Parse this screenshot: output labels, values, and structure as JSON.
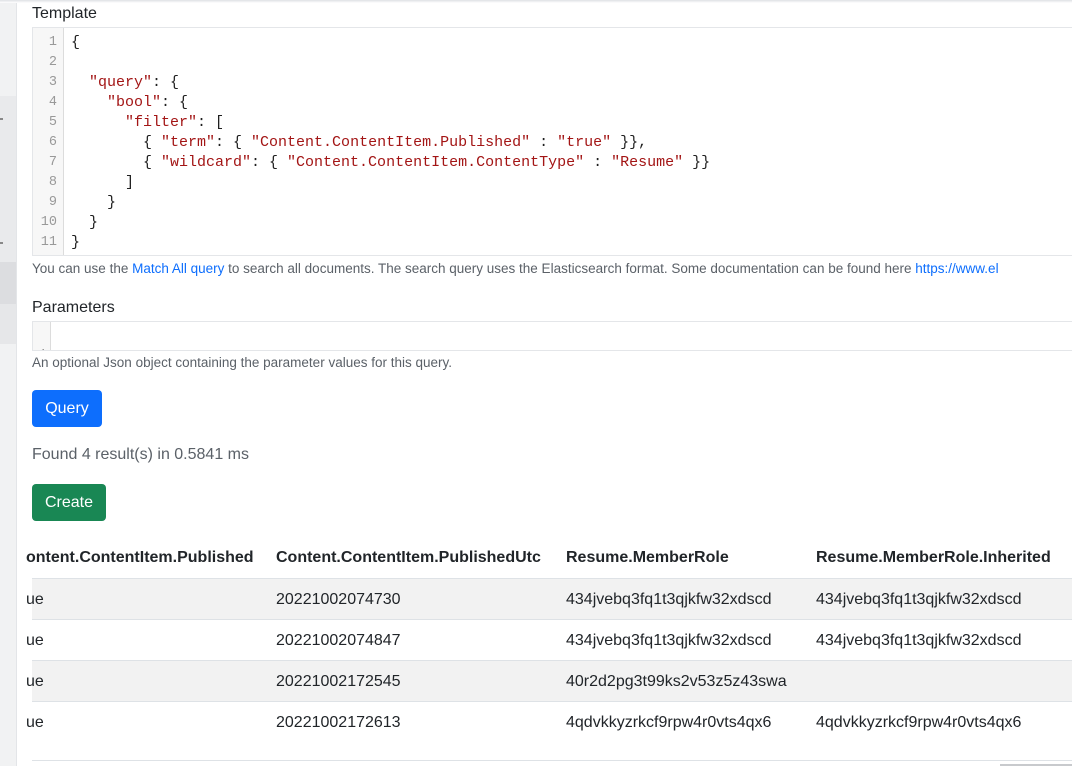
{
  "template": {
    "label": "Template",
    "lines": [
      {
        "n": "1",
        "code": "{"
      },
      {
        "n": "2",
        "code": ""
      },
      {
        "n": "3",
        "code": "  \"query\": {"
      },
      {
        "n": "4",
        "code": "    \"bool\": {"
      },
      {
        "n": "5",
        "code": "      \"filter\": ["
      },
      {
        "n": "6",
        "code": "        { \"term\": { \"Content.ContentItem.Published\" : \"true\" }},"
      },
      {
        "n": "7",
        "code": "        { \"wildcard\": { \"Content.ContentItem.ContentType\" : \"Resume\" }}"
      },
      {
        "n": "8",
        "code": "      ]"
      },
      {
        "n": "9",
        "code": "    }"
      },
      {
        "n": "10",
        "code": "  }"
      },
      {
        "n": "11",
        "code": "}"
      }
    ],
    "help_prefix": "You can use the ",
    "help_link": "Match All query",
    "help_middle": " to search all documents. The search query uses the Elasticsearch format. Some documentation can be found here ",
    "help_url": "https://www.el"
  },
  "parameters": {
    "label": "Parameters",
    "line_no": "1",
    "value": "{ }",
    "help": "An optional Json object containing the parameter values for this query."
  },
  "actions": {
    "query_label": "Query",
    "create_label": "Create"
  },
  "results_text": "Found 4 result(s) in 0.5841 ms",
  "table": {
    "headers": [
      "ontent.ContentItem.Published",
      "Content.ContentItem.PublishedUtc",
      "Resume.MemberRole",
      "Resume.MemberRole.Inherited"
    ],
    "rows": [
      [
        "ue",
        "20221002074730",
        "434jvebq3fq1t3qjkfw32xdscd",
        "434jvebq3fq1t3qjkfw32xdscd"
      ],
      [
        "ue",
        "20221002074847",
        "434jvebq3fq1t3qjkfw32xdscd",
        "434jvebq3fq1t3qjkfw32xdscd"
      ],
      [
        "ue",
        "20221002172545",
        "40r2d2pg3t99ks2v53z5z43swa",
        ""
      ],
      [
        "ue",
        "20221002172613",
        "4qdvkkyzrkcf9rpw4r0vts4qx6",
        "4qdvkkyzrkcf9rpw4r0vts4qx6"
      ]
    ]
  },
  "colors": {
    "primary": "#0d6efd",
    "success": "#198754",
    "link": "#0d6efd",
    "string": "#a31515"
  }
}
